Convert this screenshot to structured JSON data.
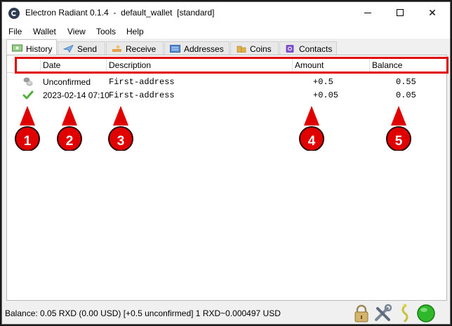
{
  "window": {
    "title": "Electron Radiant 0.1.4  -  default_wallet  [standard]",
    "controls": {
      "minimize": "minimize",
      "maximize": "maximize",
      "close": "✕"
    }
  },
  "menu": [
    "File",
    "Wallet",
    "View",
    "Tools",
    "Help"
  ],
  "tabs": [
    {
      "label": "History",
      "icon": "history-icon",
      "active": true
    },
    {
      "label": "Send",
      "icon": "send-icon",
      "active": false
    },
    {
      "label": "Receive",
      "icon": "receive-icon",
      "active": false
    },
    {
      "label": "Addresses",
      "icon": "addresses-icon",
      "active": false
    },
    {
      "label": "Coins",
      "icon": "coins-icon",
      "active": false
    },
    {
      "label": "Contacts",
      "icon": "contacts-icon",
      "active": false
    }
  ],
  "table": {
    "columns": [
      "Date",
      "Description",
      "Amount",
      "Balance"
    ],
    "rows": [
      {
        "status_icon": "unconfirmed-coins-icon",
        "date": "Unconfirmed",
        "description": "First-address",
        "amount": "+0.5",
        "balance": "0.55"
      },
      {
        "status_icon": "confirmed-check-icon",
        "date": "2023-02-14 07:10",
        "description": "First-address",
        "amount": "+0.05",
        "balance": "0.05"
      }
    ]
  },
  "markers": [
    "1",
    "2",
    "3",
    "4",
    "5"
  ],
  "status_bar": {
    "text": "Balance: 0.05 RXD (0.00 USD) [+0.5 unconfirmed] 1 RXD~0.000497 USD",
    "icons": [
      "lock-icon",
      "tools-icon",
      "seed-icon",
      "network-status-icon"
    ]
  },
  "colors": {
    "annotation_red": "#e00000",
    "connected_green": "#2fb82a"
  }
}
